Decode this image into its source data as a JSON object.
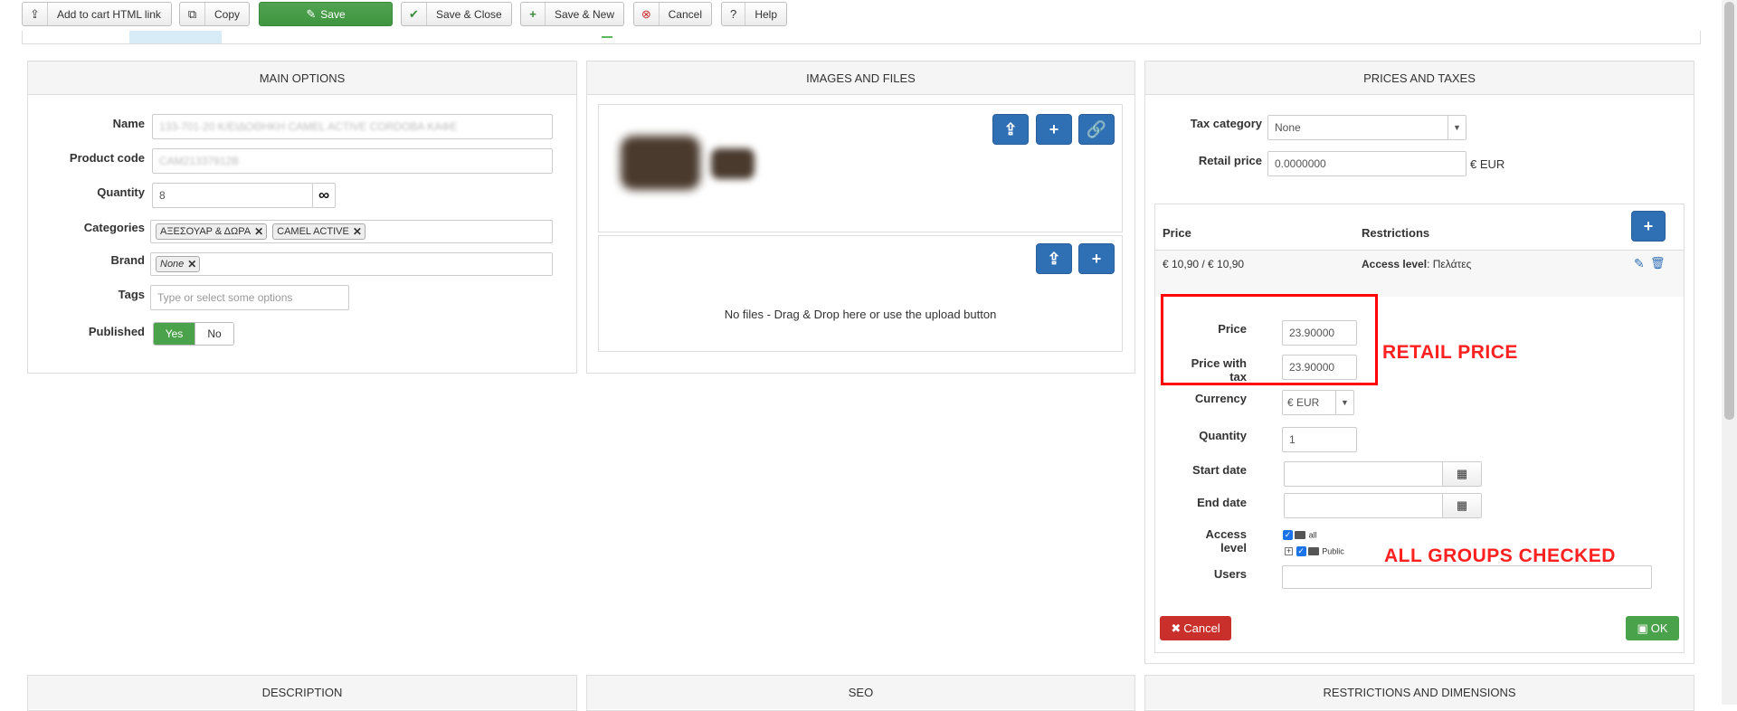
{
  "toolbar": {
    "add_to_cart": "Add to cart HTML link",
    "copy": "Copy",
    "save": "Save",
    "save_close": "Save & Close",
    "save_new": "Save & New",
    "cancel": "Cancel",
    "help": "Help"
  },
  "main_options": {
    "title": "MAIN OPTIONS",
    "name_label": "Name",
    "name_value": "133-701-20 Κ/ΕΙΔΟΘΗΚΗ CAMEL ACTIVE CORDOBA ΚΑΦΕ",
    "code_label": "Product code",
    "code_value": "CAM21337912B",
    "quantity_label": "Quantity",
    "quantity_value": "8",
    "infinity": "∞",
    "categories_label": "Categories",
    "categories": [
      "ΑΞΕΣΟΥΑΡ & ΔΩΡΑ",
      "CAMEL ACTIVE"
    ],
    "brand_label": "Brand",
    "brand_value": "None",
    "tags_label": "Tags",
    "tags_placeholder": "Type or select some options",
    "published_label": "Published",
    "yes": "Yes",
    "no": "No"
  },
  "images": {
    "title": "IMAGES AND FILES",
    "files_empty": "No files - Drag & Drop here or use the upload button"
  },
  "prices": {
    "title": "PRICES AND TAXES",
    "tax_label": "Tax category",
    "tax_value": "None",
    "retail_label": "Retail price",
    "retail_value": "0.0000000",
    "retail_currency": "€ EUR",
    "table_price_header": "Price",
    "table_restrictions_header": "Restrictions",
    "row_price": "€ 10,90 / € 10,90",
    "row_access_label": "Access level",
    "row_access_value": ": Πελάτες",
    "form": {
      "price_label": "Price",
      "price_value": "23.90000",
      "price_tax_label": "Price with tax",
      "price_tax_value": "23.90000",
      "currency_label": "Currency",
      "currency_value": "€ EUR",
      "quantity_label": "Quantity",
      "quantity_value": "1",
      "start_label": "Start date",
      "end_label": "End date",
      "access_label": "Access level",
      "access_all": "all",
      "access_public": "Public",
      "users_label": "Users",
      "cancel": "Cancel",
      "ok": "OK"
    }
  },
  "annotations": {
    "retail": "RETAIL PRICE",
    "groups": "ALL GROUPS CHECKED",
    "color": "#ff2020"
  },
  "bottom": {
    "description": "DESCRIPTION",
    "seo": "SEO",
    "restrictions": "RESTRICTIONS AND DIMENSIONS"
  },
  "colors": {
    "save_green": "#4aa24a",
    "primary_blue": "#2f6fb4",
    "cancel_red": "#c9302c"
  }
}
